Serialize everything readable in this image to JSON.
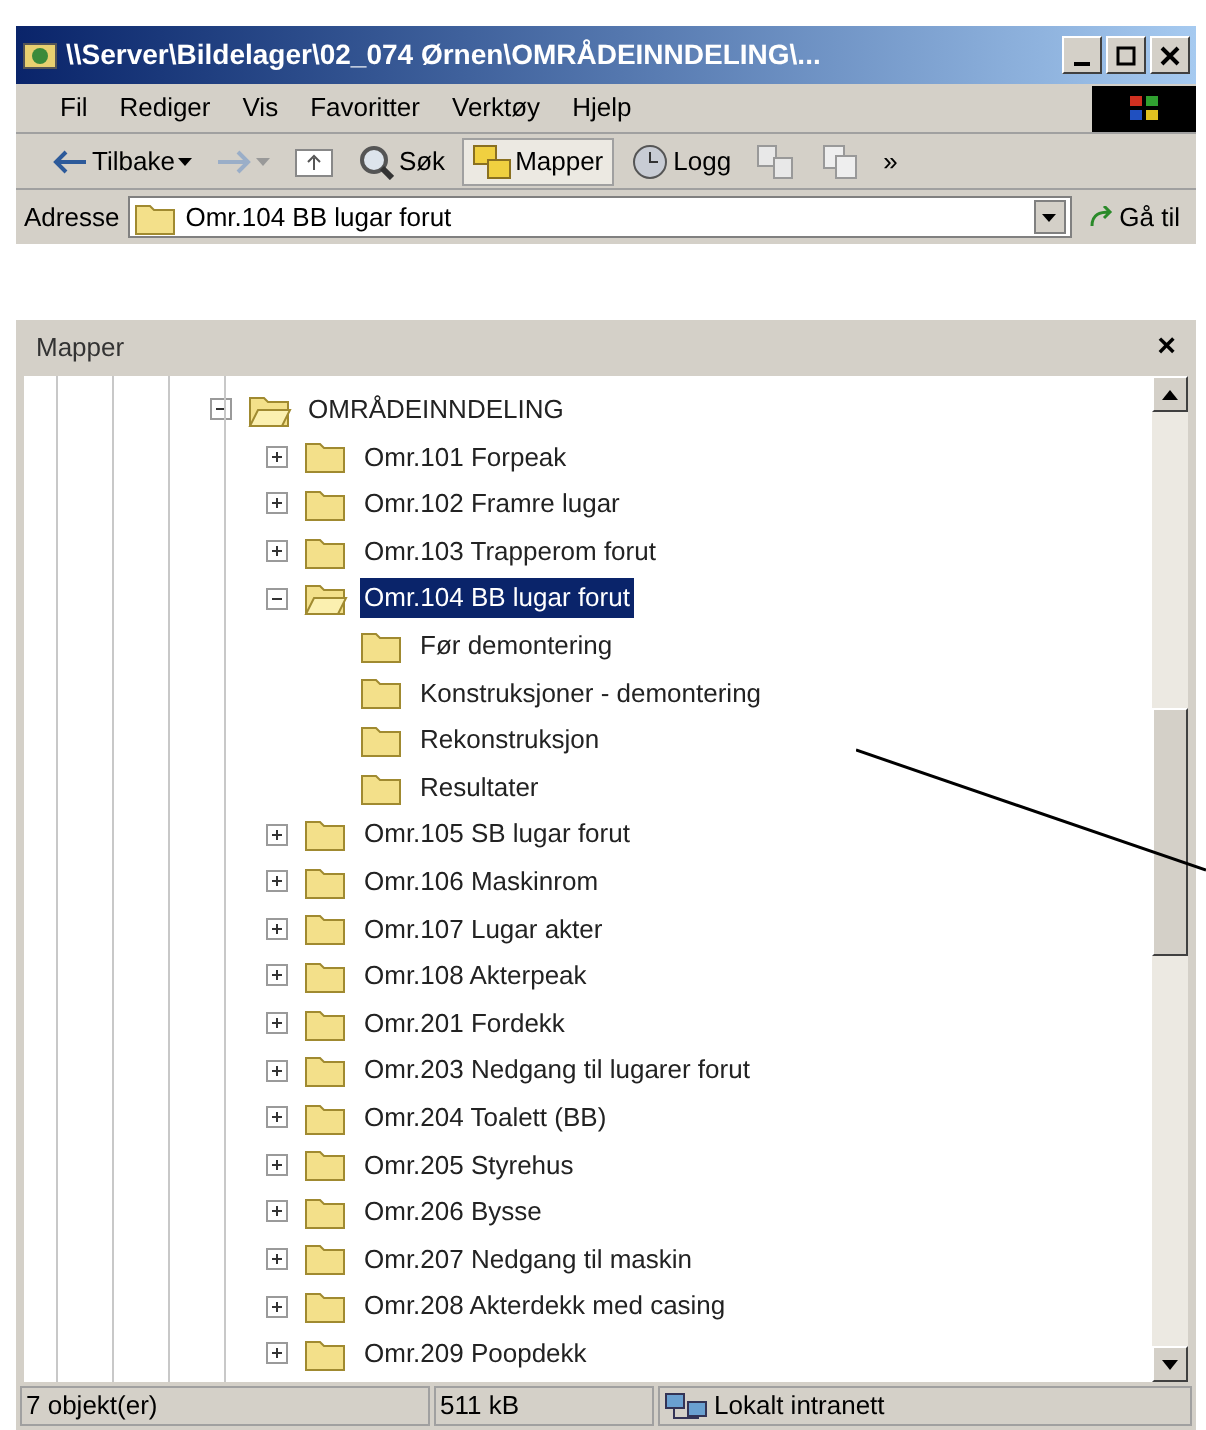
{
  "window": {
    "title": "\\\\Server\\Bildelager\\02_074 Ørnen\\OMRÅDEINNDELING\\..."
  },
  "menu": [
    "Fil",
    "Rediger",
    "Vis",
    "Favoritter",
    "Verktøy",
    "Hjelp"
  ],
  "toolbar": [
    {
      "kind": "back",
      "label": "Tilbake",
      "selected": false
    },
    {
      "kind": "forward",
      "selected": false
    },
    {
      "kind": "up",
      "selected": false
    },
    {
      "kind": "search",
      "label": "Søk",
      "selected": false
    },
    {
      "kind": "folders",
      "label": "Mapper",
      "selected": true
    },
    {
      "kind": "history",
      "label": "Logg",
      "selected": false
    },
    {
      "kind": "move",
      "selected": false
    },
    {
      "kind": "copy",
      "selected": false
    },
    {
      "kind": "more",
      "label": "»",
      "selected": false
    }
  ],
  "address": {
    "label": "Adresse",
    "value": "Omr.104 BB lugar forut",
    "go": "Gå til"
  },
  "folders_pane": {
    "title": "Mapper",
    "close": "×"
  },
  "tree": [
    {
      "label": "OMRÅDEINNDELING",
      "kind": "expandable",
      "expanded": true,
      "selected": false,
      "children": [
        {
          "label": "Omr.101 Forpeak",
          "kind": "expandable",
          "expanded": false,
          "selected": false
        },
        {
          "label": "Omr.102 Framre lugar",
          "kind": "expandable",
          "expanded": false,
          "selected": false
        },
        {
          "label": "Omr.103 Trapperom forut",
          "kind": "expandable",
          "expanded": false,
          "selected": false
        },
        {
          "label": "Omr.104 BB lugar forut",
          "kind": "expandable",
          "expanded": true,
          "selected": true,
          "children": [
            {
              "label": "Før demontering",
              "kind": "leaf",
              "expanded": false,
              "selected": false
            },
            {
              "label": "Konstruksjoner - demontering",
              "kind": "leaf",
              "expanded": false,
              "selected": false
            },
            {
              "label": "Rekonstruksjon",
              "kind": "leaf",
              "expanded": false,
              "selected": false
            },
            {
              "label": "Resultater",
              "kind": "leaf",
              "expanded": false,
              "selected": false
            }
          ]
        },
        {
          "label": "Omr.105 SB lugar forut",
          "kind": "expandable",
          "expanded": false,
          "selected": false
        },
        {
          "label": "Omr.106 Maskinrom",
          "kind": "expandable",
          "expanded": false,
          "selected": false
        },
        {
          "label": "Omr.107 Lugar akter",
          "kind": "expandable",
          "expanded": false,
          "selected": false
        },
        {
          "label": "Omr.108 Akterpeak",
          "kind": "expandable",
          "expanded": false,
          "selected": false
        },
        {
          "label": "Omr.201 Fordekk",
          "kind": "expandable",
          "expanded": false,
          "selected": false
        },
        {
          "label": "Omr.203 Nedgang til lugarer forut",
          "kind": "expandable",
          "expanded": false,
          "selected": false
        },
        {
          "label": "Omr.204 Toalett (BB)",
          "kind": "expandable",
          "expanded": false,
          "selected": false
        },
        {
          "label": "Omr.205 Styrehus",
          "kind": "expandable",
          "expanded": false,
          "selected": false
        },
        {
          "label": "Omr.206 Bysse",
          "kind": "expandable",
          "expanded": false,
          "selected": false
        },
        {
          "label": "Omr.207 Nedgang til maskin",
          "kind": "expandable",
          "expanded": false,
          "selected": false
        },
        {
          "label": "Omr.208 Akterdekk med casing",
          "kind": "expandable",
          "expanded": false,
          "selected": false
        },
        {
          "label": "Omr.209 Poopdekk",
          "kind": "expandable",
          "expanded": false,
          "selected": false
        }
      ]
    }
  ],
  "status_bar": {
    "objects": "7 objekt(er)",
    "size": "511 kB",
    "zone": "Lokalt intranett"
  }
}
